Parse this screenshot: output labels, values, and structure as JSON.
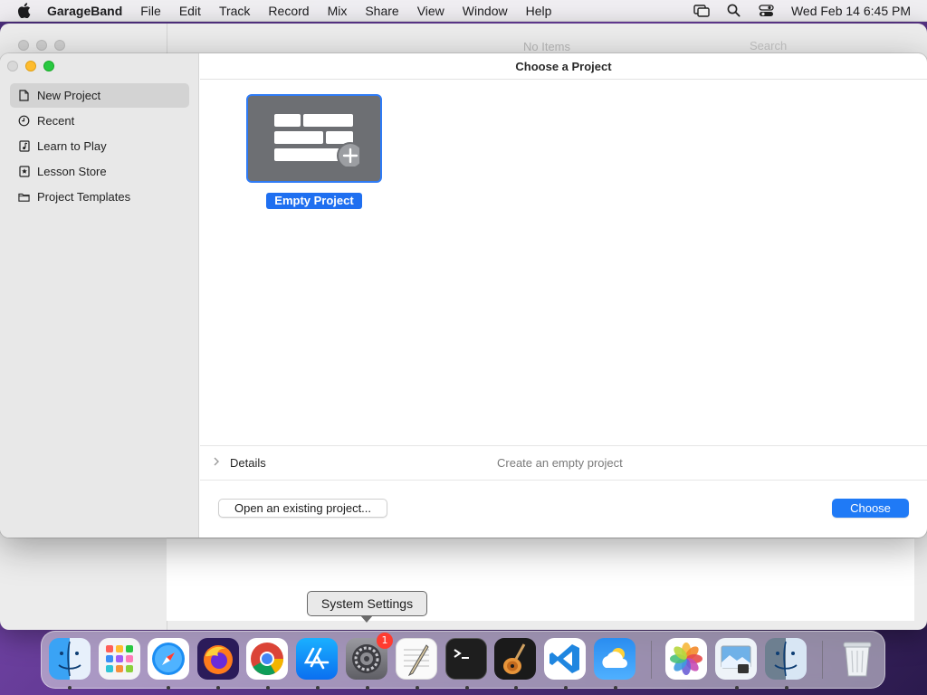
{
  "menubar": {
    "app_name": "GarageBand",
    "items": [
      "File",
      "Edit",
      "Track",
      "Record",
      "Mix",
      "Share",
      "View",
      "Window",
      "Help"
    ],
    "clock": "Wed Feb 14  6:45 PM",
    "status_icons": [
      "screen-mirroring-icon",
      "spotlight-search-icon",
      "control-center-icon"
    ]
  },
  "background_window": {
    "status_text": "No Items",
    "search_placeholder": "Search"
  },
  "dialog": {
    "title": "Choose a Project",
    "sidebar": {
      "items": [
        {
          "label": "New Project",
          "icon": "document-icon",
          "selected": true
        },
        {
          "label": "Recent",
          "icon": "clock-icon",
          "selected": false
        },
        {
          "label": "Learn to Play",
          "icon": "music-note-icon",
          "selected": false
        },
        {
          "label": "Lesson Store",
          "icon": "star-icon",
          "selected": false
        },
        {
          "label": "Project Templates",
          "icon": "folder-icon",
          "selected": false
        }
      ]
    },
    "project_tile": {
      "label": "Empty Project",
      "selected": true
    },
    "details": {
      "label": "Details",
      "description": "Create an empty project"
    },
    "buttons": {
      "open_existing": "Open an existing project...",
      "choose": "Choose"
    }
  },
  "tooltip": {
    "text": "System Settings"
  },
  "dock": {
    "apps": [
      {
        "name": "Finder",
        "running": true
      },
      {
        "name": "Launchpad",
        "running": false
      },
      {
        "name": "Safari",
        "running": true
      },
      {
        "name": "Firefox",
        "running": true
      },
      {
        "name": "Chrome",
        "running": true
      },
      {
        "name": "App Store",
        "running": true
      },
      {
        "name": "System Settings",
        "running": true,
        "badge": "1"
      },
      {
        "name": "TextEdit",
        "running": true
      },
      {
        "name": "Terminal",
        "running": true
      },
      {
        "name": "GarageBand",
        "running": true
      },
      {
        "name": "Visual Studio Code",
        "running": true
      },
      {
        "name": "Weather",
        "running": true
      },
      {
        "name": "Photos",
        "running": false
      },
      {
        "name": "Preview",
        "running": true
      },
      {
        "name": "Finder 2",
        "running": true
      },
      {
        "name": "Trash",
        "running": false
      }
    ]
  },
  "colors": {
    "accent": "#1f7af6",
    "selection_label": "#1f6ff0",
    "sidebar_bg": "#e8e8e8"
  }
}
